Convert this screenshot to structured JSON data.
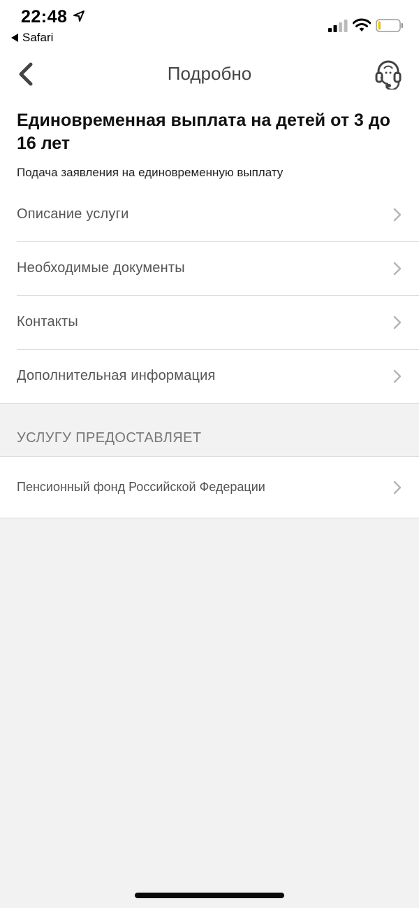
{
  "status_bar": {
    "time": "22:48",
    "back_app": "Safari",
    "icons": [
      "location-arrow-icon",
      "signal-icon",
      "wifi-icon",
      "battery-icon"
    ],
    "battery_color": "#f5c400"
  },
  "nav": {
    "title": "Подробно",
    "back_icon": "chevron-left-icon",
    "support_icon": "headset-icon"
  },
  "service": {
    "title": "Единовременная выплата на детей от 3 до 16 лет",
    "subtitle": "Подача заявления на единовременную выплату"
  },
  "menu": {
    "items": [
      {
        "label": "Описание услуги"
      },
      {
        "label": "Необходимые документы"
      },
      {
        "label": "Контакты"
      },
      {
        "label": "Дополнительная информация"
      }
    ]
  },
  "provider_section": {
    "header": "УСЛУГУ ПРЕДОСТАВЛЯЕТ",
    "provider": "Пенсионный фонд Российской Федерации"
  },
  "colors": {
    "background": "#f2f2f2",
    "card": "#ffffff",
    "chevron": "#b5b5b5"
  }
}
